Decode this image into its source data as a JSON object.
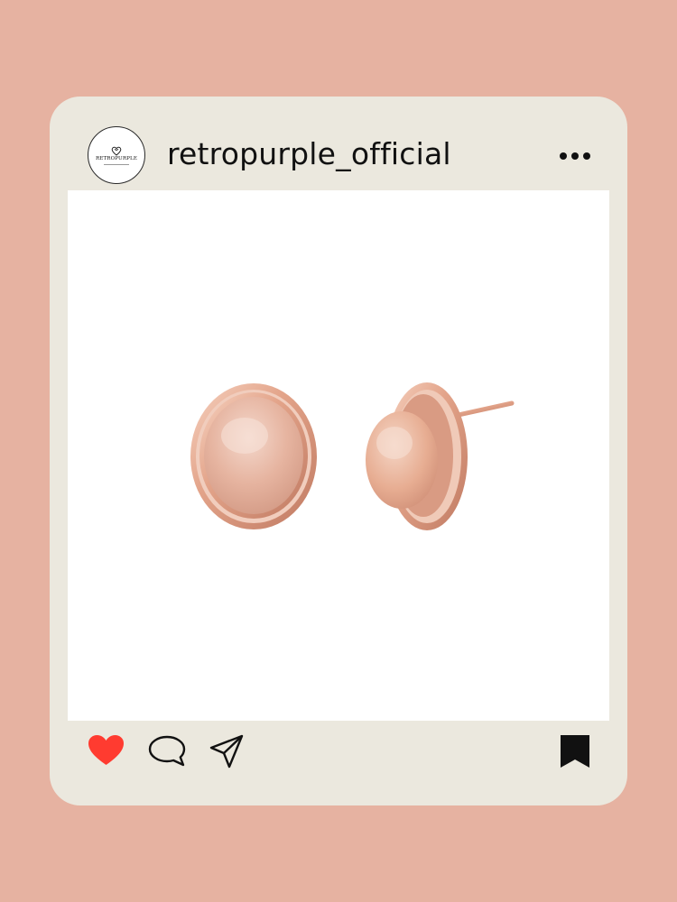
{
  "post": {
    "username": "retropurple_official",
    "avatar_brand": "RETROPURPLE"
  },
  "icons": {
    "more": "more-options-icon",
    "like": "heart-icon",
    "comment": "comment-icon",
    "share": "send-icon",
    "save": "bookmark-icon"
  },
  "colors": {
    "background": "#e6b2a1",
    "card": "#ebe8de",
    "like": "#ff3b30",
    "text": "#111111"
  }
}
